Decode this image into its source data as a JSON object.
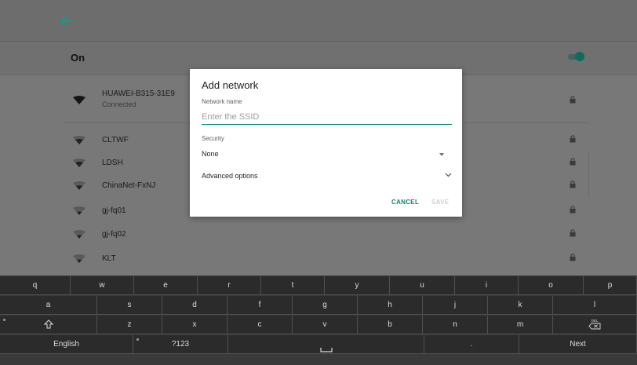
{
  "header": {
    "back_icon": "arrow-left-icon"
  },
  "wifi_toggle": {
    "label": "On",
    "state": "on",
    "accent": "#0f6b5e"
  },
  "networks": [
    {
      "name": "HUAWEI-B315-31E9",
      "status": "Connected",
      "secured": true
    },
    {
      "name": "CLTWF",
      "secured": true
    },
    {
      "name": "LDSH",
      "secured": true
    },
    {
      "name": "ChinaNet-FxNJ",
      "secured": true
    },
    {
      "name": "gj-fq01",
      "secured": true
    },
    {
      "name": "gj-fq02",
      "secured": true
    },
    {
      "name": "KLT",
      "secured": true
    }
  ],
  "dialog": {
    "title": "Add network",
    "network_name_label": "Network name",
    "ssid_placeholder": "Enter the SSID",
    "ssid_value": "",
    "security_label": "Security",
    "security_value": "None",
    "advanced_label": "Advanced options",
    "cancel_label": "CANCEL",
    "save_label": "SAVE",
    "accent": "#167f73"
  },
  "keyboard": {
    "row1": [
      "q",
      "w",
      "e",
      "r",
      "t",
      "y",
      "u",
      "i",
      "o",
      "p"
    ],
    "row2": [
      "a",
      "s",
      "d",
      "f",
      "g",
      "h",
      "j",
      "k",
      "l"
    ],
    "row3": [
      "z",
      "x",
      "c",
      "v",
      "b",
      "n",
      "m"
    ],
    "delete_label": "DEL",
    "language_label": "English",
    "symbols_label": "?123",
    "period_label": ".",
    "next_label": "Next",
    "shift_icon": "shift-icon",
    "space_icon": "space-icon",
    "delete_icon": "backspace-icon"
  }
}
